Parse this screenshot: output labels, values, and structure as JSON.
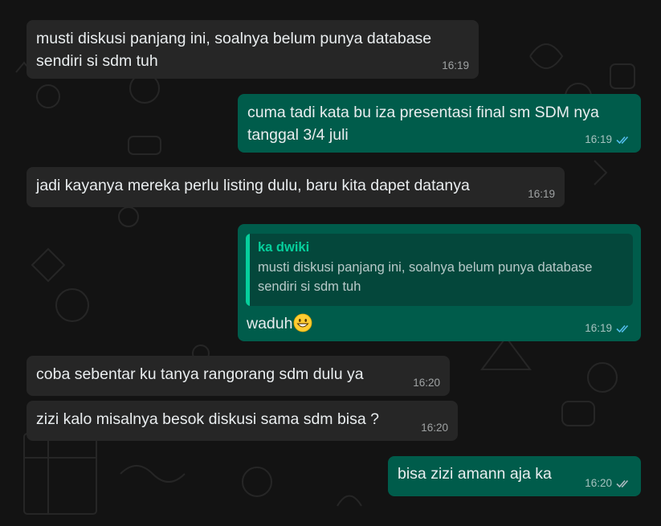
{
  "colors": {
    "background": "#131313",
    "incoming_bubble": "#262626",
    "outgoing_bubble": "#005c4b",
    "read_ticks": "#53bdeb",
    "quote_accent": "#06cf9c"
  },
  "messages": [
    {
      "direction": "in",
      "text": "musti diskusi panjang ini, soalnya belum punya database\nsendiri si sdm tuh",
      "time": "16:19"
    },
    {
      "direction": "out",
      "text": "cuma tadi kata bu iza presentasi final sm SDM nya\ntanggal 3/4 juli",
      "time": "16:19",
      "status_icon": "double-check-read-icon"
    },
    {
      "direction": "in",
      "text": "jadi kayanya mereka perlu listing dulu, baru kita dapet datanya",
      "time": "16:19"
    },
    {
      "direction": "out",
      "quoted": {
        "author": "ka dwiki",
        "text": "musti diskusi panjang ini, soalnya belum punya database\nsendiri si sdm tuh"
      },
      "text": "waduh",
      "emoji": "grinning-face-emoji",
      "time": "16:19",
      "status_icon": "double-check-read-icon"
    },
    {
      "direction": "in",
      "text": "coba sebentar ku tanya rangorang sdm dulu ya",
      "time": "16:20"
    },
    {
      "direction": "in",
      "text": "zizi kalo misalnya besok diskusi sama sdm bisa ?",
      "time": "16:20"
    },
    {
      "direction": "out",
      "text": "bisa zizi amann aja ka",
      "time": "16:20",
      "status_icon": "double-check-delivered-icon"
    }
  ]
}
